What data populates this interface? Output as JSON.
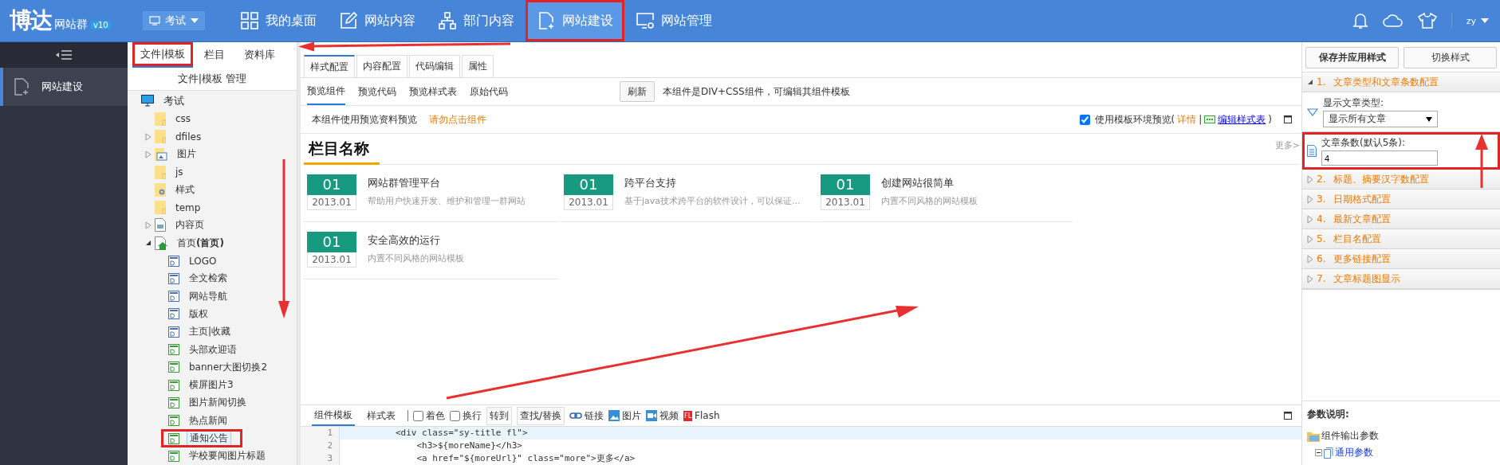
{
  "top_bar": {
    "logo": "博达",
    "product": "网站群",
    "version": "v10",
    "site_selector": "考试",
    "nav": [
      {
        "label": "我的桌面",
        "selected": false
      },
      {
        "label": "网站内容",
        "selected": false
      },
      {
        "label": "部门内容",
        "selected": false
      },
      {
        "label": "网站建设",
        "selected": true
      },
      {
        "label": "网站管理",
        "selected": false
      }
    ],
    "user": "zy"
  },
  "sidebar": {
    "items": [
      {
        "label": "网站建设",
        "selected": true
      }
    ]
  },
  "file_panel": {
    "tabs": [
      {
        "label": "文件|模板",
        "selected": true
      },
      {
        "label": "栏目",
        "selected": false
      },
      {
        "label": "资料库",
        "selected": false
      }
    ],
    "title": "文件|模板 管理",
    "tree": [
      {
        "label": "考试",
        "kind": "site",
        "selected": false,
        "children": [
          {
            "label": "css",
            "kind": "folder",
            "selected": false
          },
          {
            "label": "dfiles",
            "kind": "folder",
            "expanded": false,
            "selected": false
          },
          {
            "label": "图片",
            "kind": "folder-image",
            "expanded": false,
            "selected": false
          },
          {
            "label": "js",
            "kind": "folder",
            "selected": false
          },
          {
            "label": "样式",
            "kind": "folder-gear",
            "selected": false
          },
          {
            "label": "temp",
            "kind": "folder",
            "selected": false
          },
          {
            "label": "内容页",
            "kind": "page",
            "expanded": false,
            "selected": false
          },
          {
            "label": "首页**(首页)**",
            "kind": "page-home",
            "expanded": true,
            "selected": false,
            "children": [
              {
                "label": "LOGO",
                "kind": "component-blue",
                "selected": false
              },
              {
                "label": "全文检索",
                "kind": "component-blue",
                "selected": false
              },
              {
                "label": "网站导航",
                "kind": "component-blue",
                "selected": false
              },
              {
                "label": "版权",
                "kind": "component-blue",
                "selected": false
              },
              {
                "label": "主页|收藏",
                "kind": "component-blue",
                "selected": false
              },
              {
                "label": "头部欢迎语",
                "kind": "component-green",
                "selected": false
              },
              {
                "label": "banner大图切换2",
                "kind": "component-green",
                "selected": false
              },
              {
                "label": "横屏图片3",
                "kind": "component-green",
                "selected": false
              },
              {
                "label": "图片新闻切换",
                "kind": "component-green",
                "selected": false
              },
              {
                "label": "热点新闻",
                "kind": "component-green",
                "selected": false
              },
              {
                "label": "通知公告",
                "kind": "component-green",
                "selected": true
              },
              {
                "label": "学校要闻图片标题",
                "kind": "component-green",
                "selected": false
              }
            ]
          }
        ]
      }
    ]
  },
  "editor": {
    "tabs": [
      {
        "label": "样式配置",
        "selected": true
      },
      {
        "label": "内容配置",
        "selected": false
      },
      {
        "label": "代码编辑",
        "selected": false
      },
      {
        "label": "属性",
        "selected": false
      }
    ],
    "preview_tabs": [
      {
        "label": "预览组件",
        "selected": true
      },
      {
        "label": "预览代码",
        "selected": false
      },
      {
        "label": "预览样式表",
        "selected": false
      },
      {
        "label": "原始代码",
        "selected": false
      }
    ],
    "refresh_button": "刷新",
    "description": "本组件是DIV+CSS组件，可编辑其组件模板",
    "preview": {
      "notice": "本组件使用预览资料预览",
      "warning": "请勿点击组件",
      "use_template_env": {
        "label": "使用模板环境预览(",
        "checked": true
      },
      "details_link": "详情",
      "separator": "|",
      "stylesheet_link": "编辑样式表",
      "close_paren": ")",
      "heading": "栏目名称",
      "more": "更多>",
      "articles": [
        {
          "day": "01",
          "date": "2013.01",
          "title": "网站群管理平台",
          "summary": "帮助用户快速开发、维护和管理一群网站"
        },
        {
          "day": "01",
          "date": "2013.01",
          "title": "跨平台支持",
          "summary": "基于java技术跨平台的软件设计，可以保证..."
        },
        {
          "day": "01",
          "date": "2013.01",
          "title": "创建网站很简单",
          "summary": "内置不同风格的网站模板"
        },
        {
          "day": "01",
          "date": "2013.01",
          "title": "安全高效的运行",
          "summary": "内置不同风格的网站模板"
        }
      ]
    },
    "code": {
      "tabs": [
        {
          "label": "组件模板",
          "selected": true
        },
        {
          "label": "样式表",
          "selected": false
        }
      ],
      "options": [
        {
          "label": "着色",
          "checked": false
        },
        {
          "label": "换行",
          "checked": false
        }
      ],
      "tools": [
        {
          "label": "转到",
          "kind": "button"
        },
        {
          "label": "查找/替换",
          "kind": "button"
        },
        {
          "label": "链接",
          "kind": "link"
        },
        {
          "label": "图片",
          "kind": "image"
        },
        {
          "label": "视频",
          "kind": "video"
        },
        {
          "label": "Flash",
          "kind": "flash",
          "badge": "FL"
        }
      ],
      "lines": [
        {
          "number": "1",
          "text": "<div class=\"sy-title fl\">",
          "current": true
        },
        {
          "number": "2",
          "text": "    <h3>${moreName}</h3>",
          "current": false
        },
        {
          "number": "3",
          "text": "    <a href=\"${moreUrl}\" class=\"more\">更多</a>",
          "current": false
        }
      ]
    }
  },
  "style_panel": {
    "save_button": "保存并应用样式",
    "switch_button": "切换样式",
    "sections": [
      {
        "number": "1.",
        "title": "文章类型和文章条数配置",
        "expanded": true
      },
      {
        "number": "2.",
        "title": "标题、摘要汉字数配置",
        "expanded": false
      },
      {
        "number": "3.",
        "title": "日期格式配置",
        "expanded": false
      },
      {
        "number": "4.",
        "title": "最新文章配置",
        "expanded": false
      },
      {
        "number": "5.",
        "title": "栏目名配置",
        "expanded": false
      },
      {
        "number": "6.",
        "title": "更多链接配置",
        "expanded": false
      },
      {
        "number": "7.",
        "title": "文章标题图显示",
        "expanded": false
      }
    ],
    "type_label": "显示文章类型:",
    "type_value": "显示所有文章",
    "count_label": "文章条数(默认5条):",
    "count_value": "4",
    "params_title": "参数说明:",
    "params_tree": [
      {
        "label": "组件输出参数",
        "children": [
          {
            "label": "通用参数",
            "expanded": true
          }
        ]
      }
    ]
  }
}
